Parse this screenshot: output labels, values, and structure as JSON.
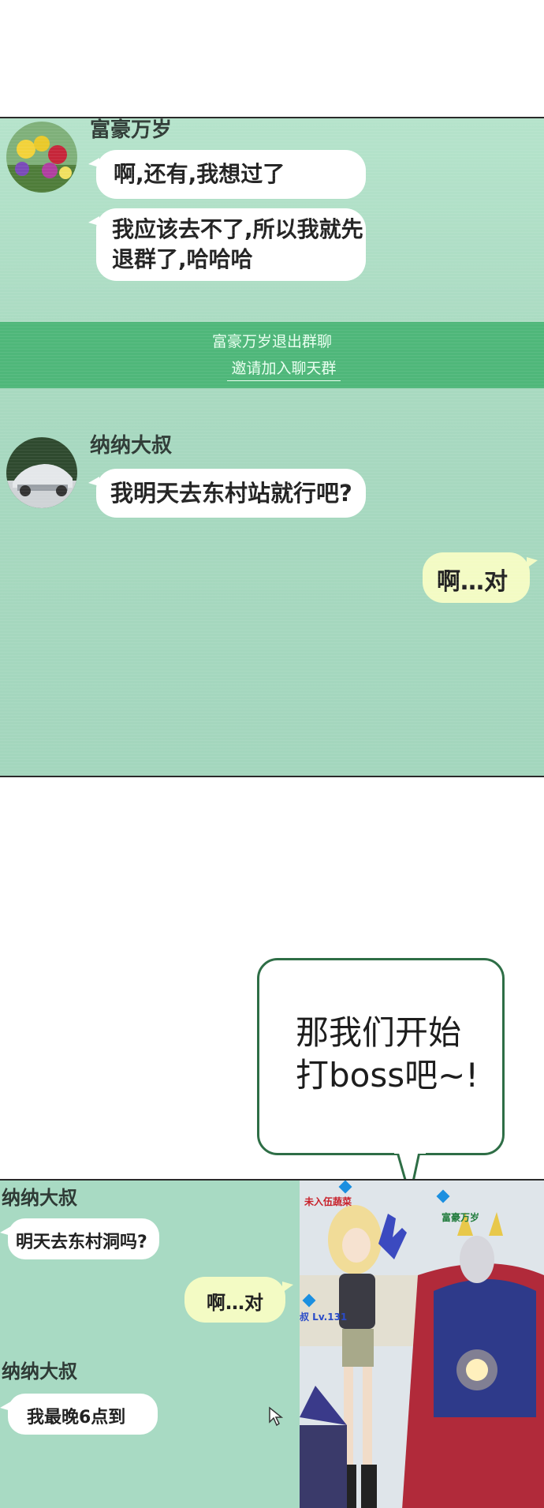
{
  "chat1": {
    "sender_top": "富豪万岁",
    "msg1": "啊,还有,我想过了",
    "msg2_line1": "我应该去不了,所以我就先",
    "msg2_line2": "退群了,哈哈哈",
    "notice": "富豪万岁退出群聊",
    "invite": "邀请加入聊天群",
    "sender2": "纳纳大叔",
    "msg3": "我明天去东村站就行吧?",
    "my_reply": "啊…对"
  },
  "speech": {
    "line1": "那我们开始",
    "line2": "打boss吧~!"
  },
  "chat2": {
    "sender1": "纳纳大叔",
    "msg1": "明天去东村洞吗?",
    "my_reply": "啊…对",
    "sender2": "纳纳大叔",
    "msg2": "我最晚6点到"
  },
  "game": {
    "tag_left": "未入伍蔬菜",
    "tag_right": "富豪万岁",
    "level": "叔 Lv.131"
  },
  "colors": {
    "chat_bg": "#a9dac1",
    "notice_band": "#4fb77a",
    "my_bubble": "#f3fbc4",
    "speech_border": "#2e6e46"
  }
}
